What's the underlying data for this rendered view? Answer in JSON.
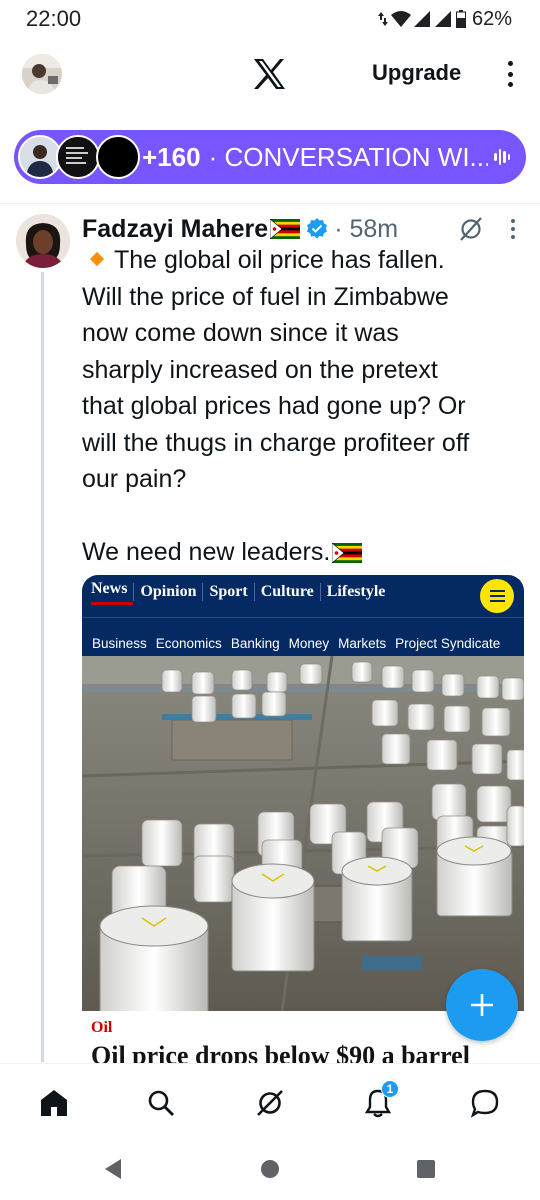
{
  "status_bar": {
    "time": "22:00",
    "battery": "62%"
  },
  "header": {
    "logo": "x-logo",
    "upgrade_label": "Upgrade",
    "menu_icon": "more-vertical-icon"
  },
  "conversation_pill": {
    "count": "+160",
    "label": "· CONVERSATION WI...",
    "accent": "#7856ff"
  },
  "tweet": {
    "author": "Fadzayi Mahere",
    "verified": true,
    "time": "· 58m",
    "lines": [
      "The global oil price has fallen.",
      "Will the price of fuel in Zimbabwe",
      "now come down since it was",
      "sharply increased on the pretext",
      "that global prices had gone up? Or",
      "will the thugs in charge profiteer off",
      "our pain?"
    ],
    "closing": "We need new leaders."
  },
  "media_card": {
    "nav_items": [
      "News",
      "Opinion",
      "Sport",
      "Culture",
      "Lifestyle"
    ],
    "sub_items": [
      "Business",
      "Economics",
      "Banking",
      "Money",
      "Markets",
      "Project Syndicate"
    ],
    "kicker": "Oil",
    "headline": "Oil price drops below $90 a barrel"
  },
  "compose_fab": {
    "icon": "plus-icon",
    "color": "#1d9bf0"
  },
  "bottom_nav": {
    "items": [
      "home-icon",
      "search-icon",
      "grok-icon",
      "notifications-icon",
      "messages-icon"
    ],
    "notification_count": "1"
  },
  "android_nav": [
    "back-icon",
    "home-circle-icon",
    "recents-icon"
  ]
}
